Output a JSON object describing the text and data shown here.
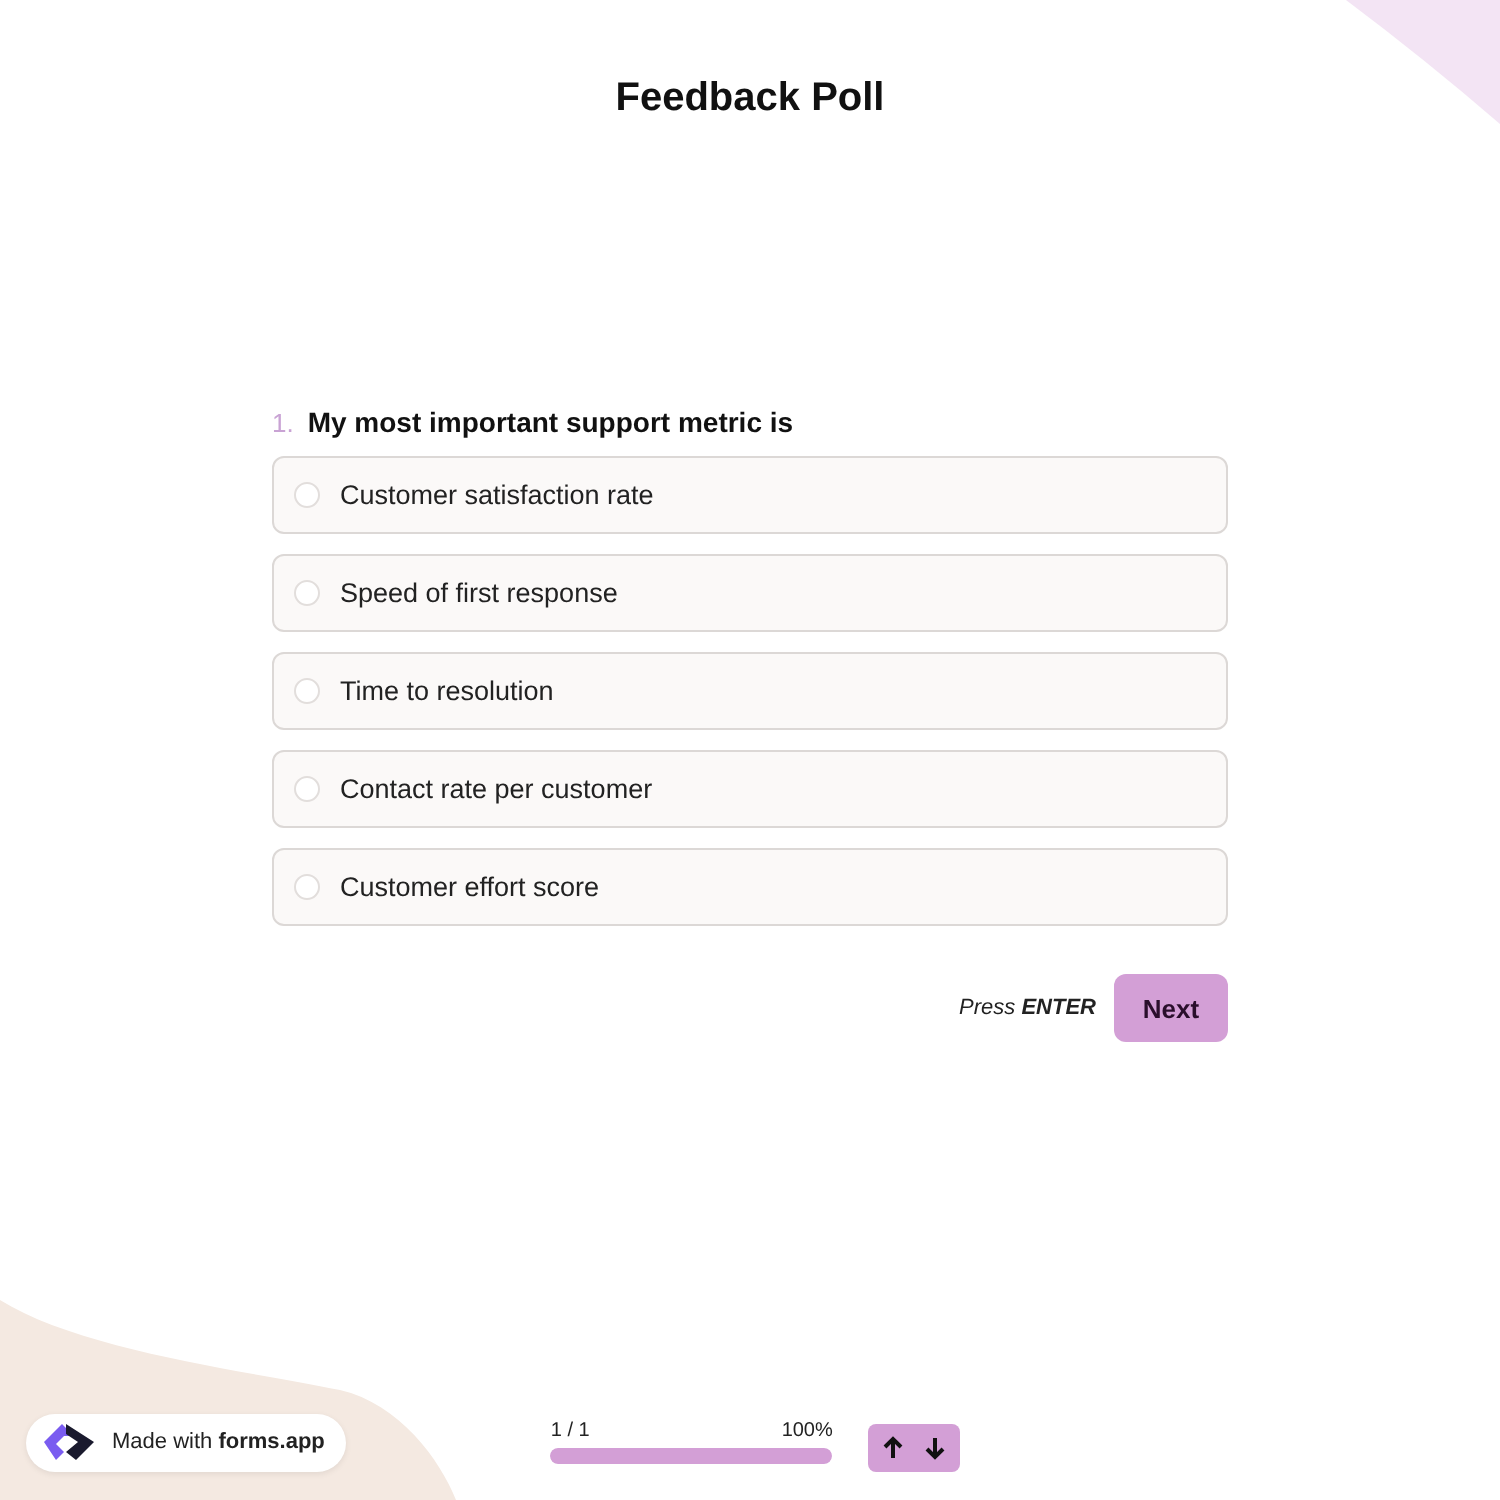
{
  "title": "Feedback Poll",
  "question": {
    "number": "1.",
    "text": "My most important support metric is",
    "options": [
      {
        "label": "Customer satisfaction rate",
        "selected": false
      },
      {
        "label": "Speed of first response",
        "selected": false
      },
      {
        "label": "Time to resolution",
        "selected": false
      },
      {
        "label": "Contact rate per customer",
        "selected": false
      },
      {
        "label": "Customer effort score",
        "selected": false
      }
    ]
  },
  "hint": "Press **ENTER**",
  "next_button": "Next",
  "badge": {
    "prefix": "Made with",
    "brand": "forms.app"
  },
  "progress": {
    "count": "1 / 1",
    "percent": "100%",
    "level": 1
  }
}
